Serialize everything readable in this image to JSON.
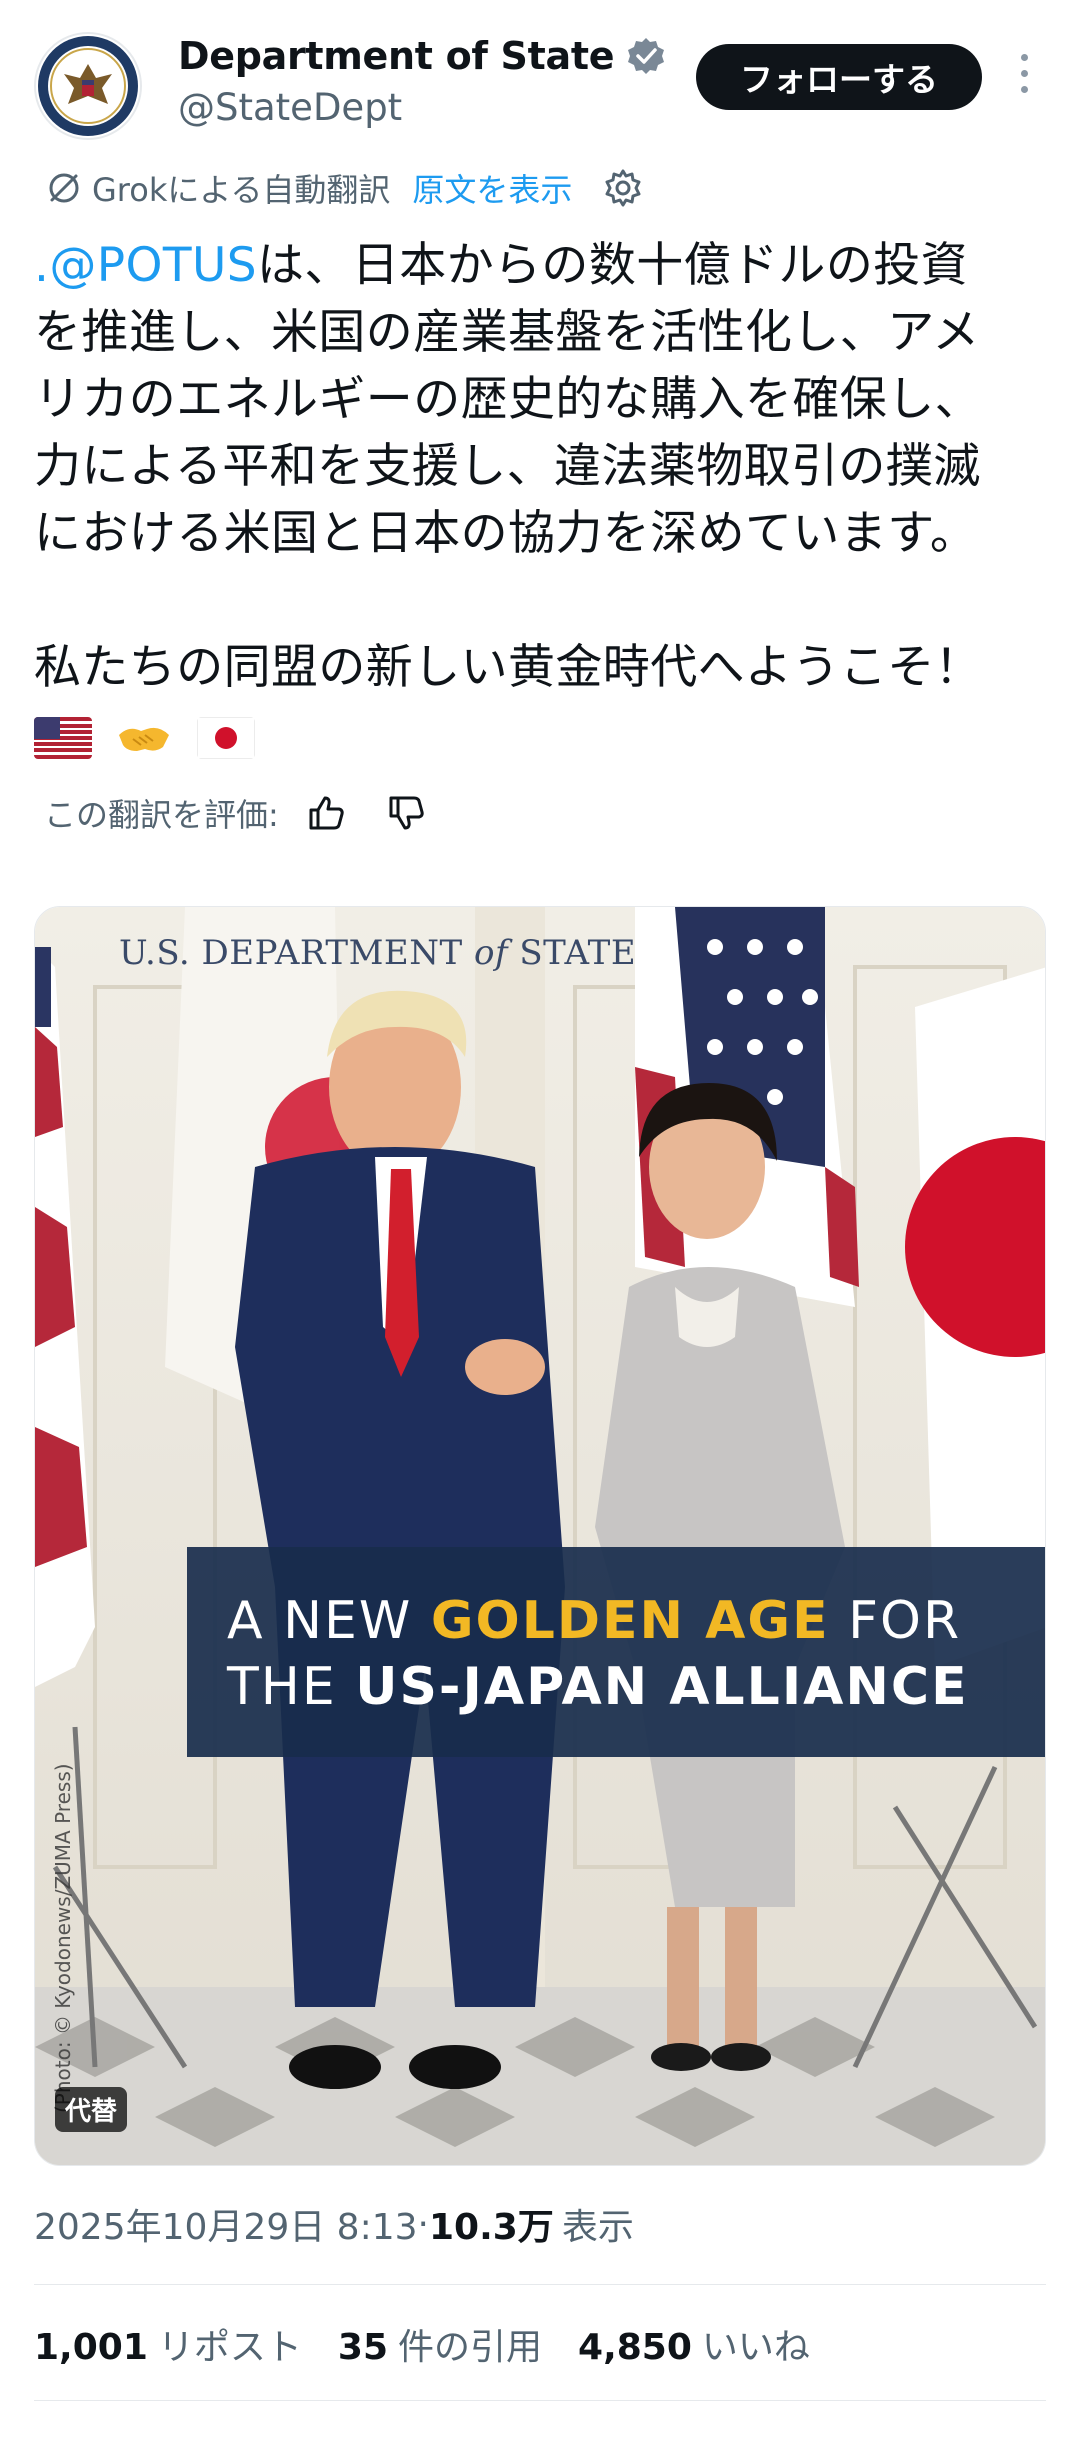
{
  "account": {
    "display_name": "Department of State",
    "handle": "@StateDept",
    "follow_label": "フォローする"
  },
  "translation": {
    "label": "Grokによる自動翻訳",
    "show_original": "原文を表示",
    "rate_label": "この翻訳を評価:"
  },
  "tweet": {
    "mention": ".@POTUS",
    "line1_rest": "は、日本からの数十億ドルの投資",
    "line2": "を推進し、米国の産業基盤を活性化し、アメ",
    "line3": "リカのエネルギーの歴史的な購入を確保し、",
    "line4": "力による平和を支援し、違法薬物取引の撲滅",
    "line5": "における米国と日本の協力を深めています。",
    "line6": "私たちの同盟の新しい黄金時代へようこそ！",
    "emojis": [
      "us-flag",
      "handshake",
      "japan-flag"
    ]
  },
  "image": {
    "header_prefix": "U.S. DEPARTMENT ",
    "header_of": "of",
    "header_suffix": " STATE",
    "banner_a": "A NEW ",
    "banner_gold": "GOLDEN AGE",
    "banner_b": " FOR",
    "banner_c": "THE ",
    "banner_bold": "US-JAPAN ALLIANCE",
    "credit": "(Photo: © Kyodonews/ZUMA Press)",
    "alt_badge": "代替"
  },
  "meta": {
    "date_time": "2025年10月29日 8:13",
    "separator": " · ",
    "views_count": "10.3万",
    "views_label": "表示"
  },
  "stats": {
    "reposts_count": "1,001",
    "reposts_label": "リポスト",
    "quotes_count": "35",
    "quotes_label": "件の引用",
    "likes_count": "4,850",
    "likes_label": "いいね"
  },
  "colors": {
    "accent_blue": "#1d9bf0",
    "banner_navy": "#182c4c",
    "banner_gold": "#f2b824"
  }
}
